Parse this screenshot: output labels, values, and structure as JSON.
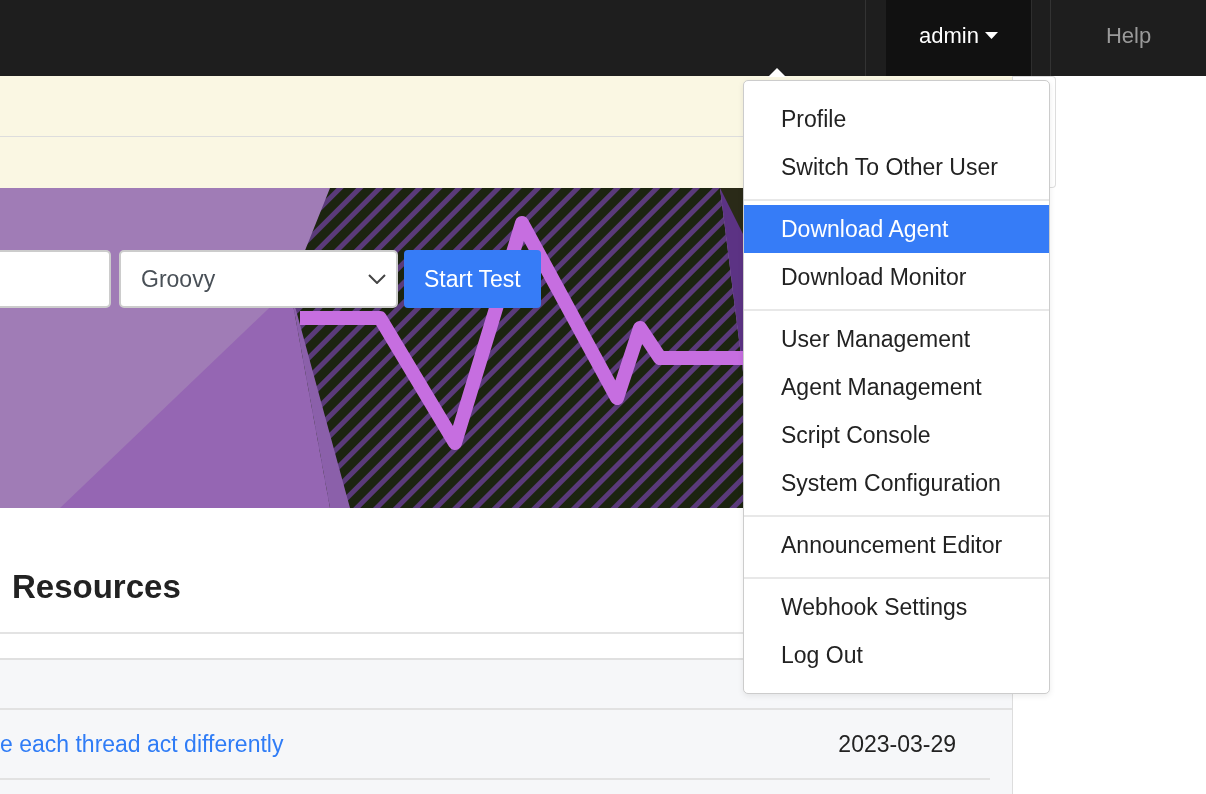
{
  "navbar": {
    "user_menu": {
      "label": "admin",
      "expanded": true
    },
    "help": "Help"
  },
  "test_form": {
    "script_type": "Groovy",
    "button": "Start Test"
  },
  "section": {
    "title": "Resources"
  },
  "table": {
    "rows": [
      {
        "title": "e each thread act differently",
        "date": "2023-03-29"
      }
    ]
  },
  "user_dropdown": {
    "groups": [
      {
        "items": [
          {
            "label": "Profile",
            "selected": false
          },
          {
            "label": "Switch To Other User",
            "selected": false
          }
        ]
      },
      {
        "items": [
          {
            "label": "Download Agent",
            "selected": true
          },
          {
            "label": "Download Monitor",
            "selected": false
          }
        ]
      },
      {
        "items": [
          {
            "label": "User Management",
            "selected": false
          },
          {
            "label": "Agent Management",
            "selected": false
          },
          {
            "label": "Script Console",
            "selected": false
          },
          {
            "label": "System Configuration",
            "selected": false
          }
        ]
      },
      {
        "items": [
          {
            "label": "Announcement Editor",
            "selected": false
          }
        ]
      },
      {
        "items": [
          {
            "label": "Webhook Settings",
            "selected": false
          },
          {
            "label": "Log Out",
            "selected": false
          }
        ]
      }
    ]
  }
}
